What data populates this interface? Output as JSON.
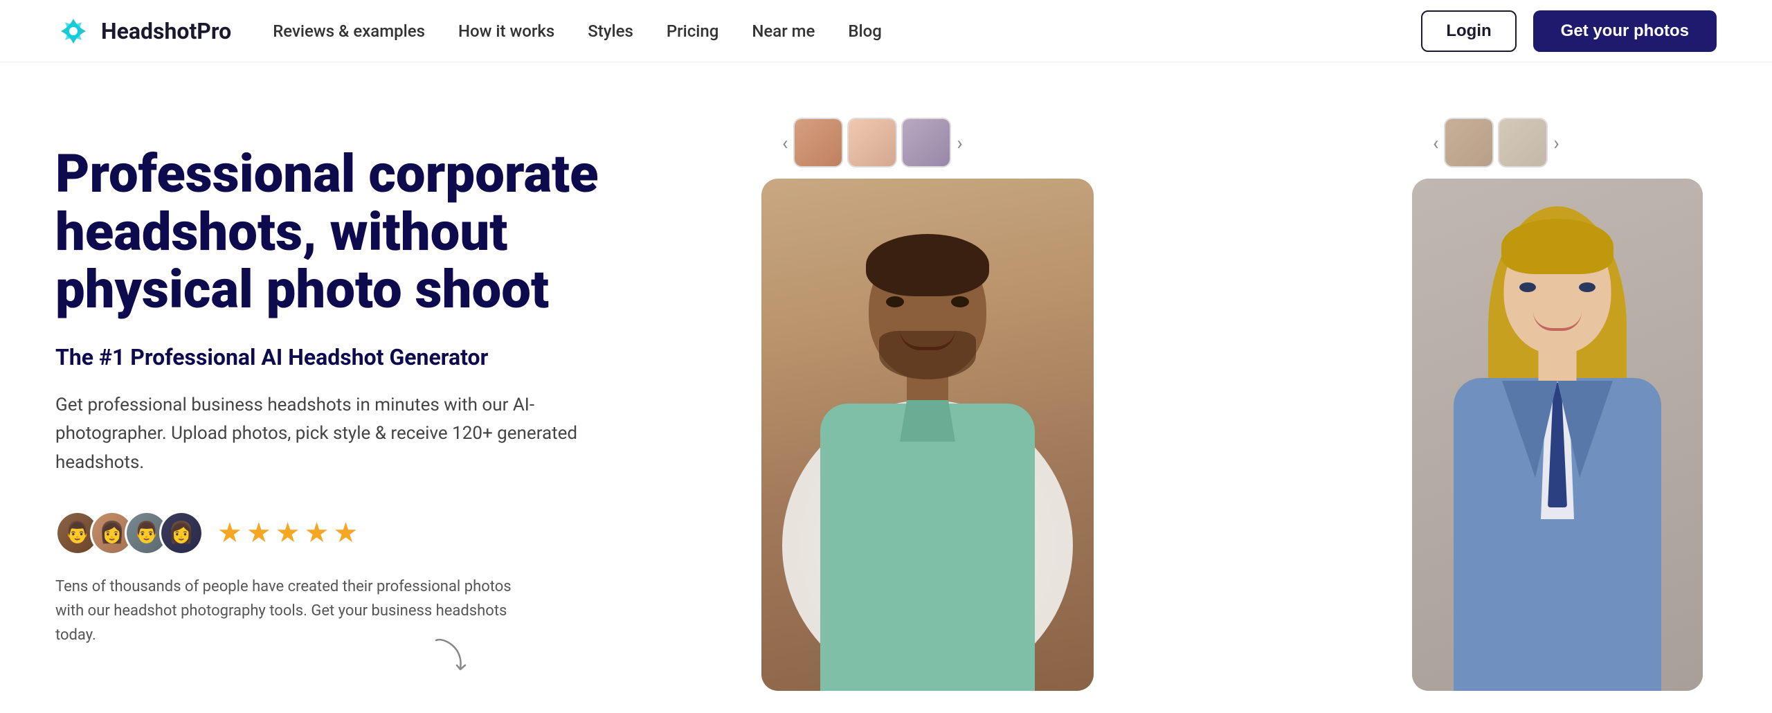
{
  "brand": {
    "name": "HeadshotPro",
    "logo_alt": "HeadshotPro logo"
  },
  "nav": {
    "links": [
      {
        "id": "reviews",
        "label": "Reviews & examples"
      },
      {
        "id": "how-it-works",
        "label": "How it works"
      },
      {
        "id": "styles",
        "label": "Styles"
      },
      {
        "id": "pricing",
        "label": "Pricing"
      },
      {
        "id": "near-me",
        "label": "Near me"
      },
      {
        "id": "blog",
        "label": "Blog"
      }
    ],
    "login_label": "Login",
    "cta_label": "Get your photos"
  },
  "hero": {
    "title": "Professional corporate headshots, without physical photo shoot",
    "subtitle": "The #1 Professional AI Headshot Generator",
    "description": "Get professional business headshots in minutes with our AI-photographer. Upload photos, pick style & receive 120+ generated headshots.",
    "social_proof": "Tens of thousands of people have created their professional photos with our headshot photography tools. Get your business headshots today.",
    "stars": [
      "★",
      "★",
      "★",
      "★",
      "★"
    ],
    "avatar_emojis": [
      "👨",
      "👩",
      "👨",
      "👩"
    ]
  }
}
